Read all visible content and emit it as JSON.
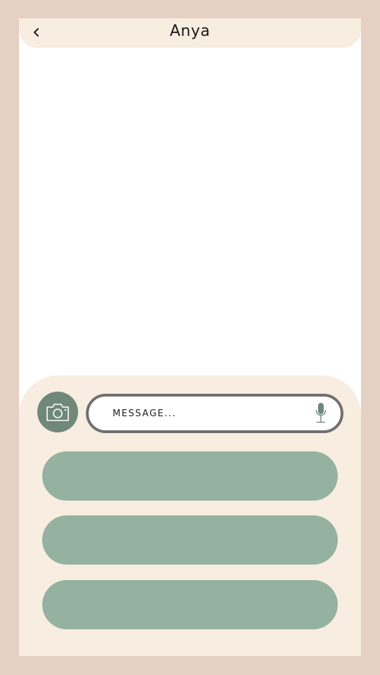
{
  "header": {
    "title": "Anya",
    "back_icon": "chevron-left-icon"
  },
  "composer": {
    "camera_icon": "camera-icon",
    "message_placeholder": "MESSAGE...",
    "message_value": "",
    "mic_icon": "microphone-icon"
  },
  "quick_replies": [
    {
      "label": ""
    },
    {
      "label": ""
    },
    {
      "label": ""
    }
  ],
  "colors": {
    "background": "#e6d0c4",
    "panel": "#f7ede0",
    "camera_button": "#6f887a",
    "pill": "#95b1a0",
    "field_border": "#707070"
  }
}
